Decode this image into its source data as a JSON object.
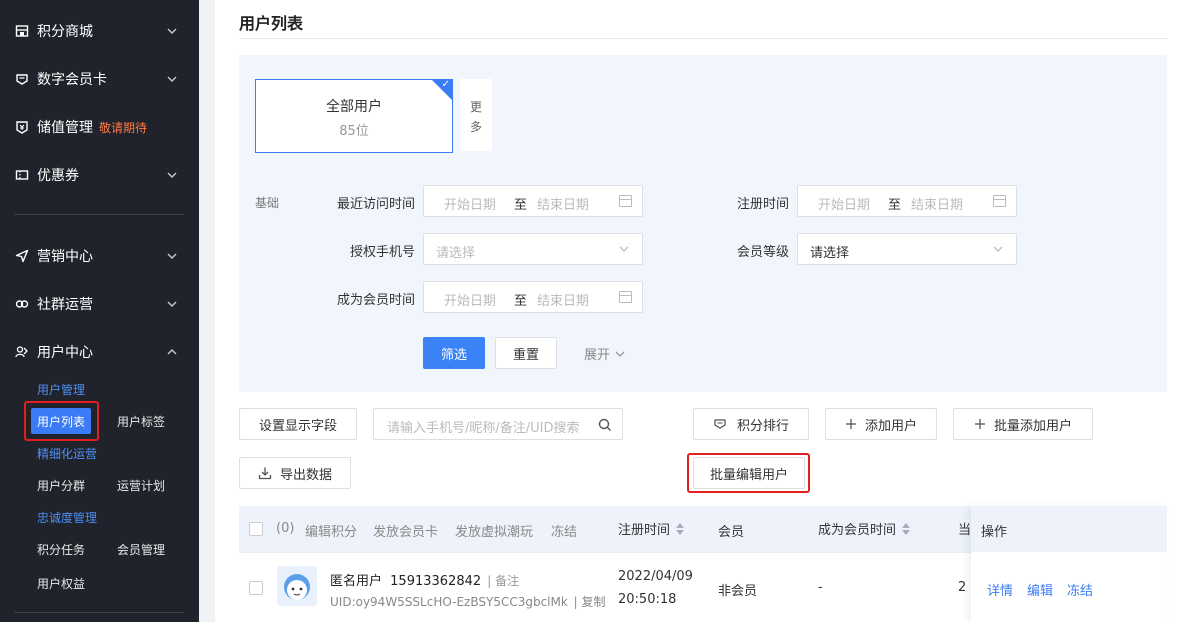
{
  "sidebar": {
    "items": [
      {
        "label": "积分商城",
        "icon": "store-icon"
      },
      {
        "label": "数字会员卡",
        "icon": "member-card-icon"
      },
      {
        "label": "储值管理",
        "icon": "wallet-icon",
        "tag": "敬请期待"
      },
      {
        "label": "优惠券",
        "icon": "coupon-icon"
      },
      {
        "label": "营销中心",
        "icon": "send-icon"
      },
      {
        "label": "社群运营",
        "icon": "community-icon"
      },
      {
        "label": "用户中心",
        "icon": "users-icon"
      }
    ],
    "groups": {
      "user_management": "用户管理",
      "refined_operation": "精细化运营",
      "loyalty_management": "忠诚度管理"
    },
    "links": {
      "user_list": "用户列表",
      "user_tags": "用户标签",
      "user_segments": "用户分群",
      "operation_plan": "运营计划",
      "points_tasks": "积分任务",
      "member_management": "会员管理",
      "user_rights": "用户权益"
    }
  },
  "page": {
    "title": "用户列表"
  },
  "filter": {
    "card_all": {
      "label": "全部用户",
      "count": "85位"
    },
    "more": [
      "更",
      "多"
    ],
    "group_label": "基础",
    "recent_visit_label": "最近访问时间",
    "register_time_label": "注册时间",
    "phone_label": "授权手机号",
    "level_label": "会员等级",
    "member_time_label": "成为会员时间",
    "start_placeholder": "开始日期",
    "end_placeholder": "结束日期",
    "to": "至",
    "select_placeholder": "请选择",
    "filter_btn": "筛选",
    "reset_btn": "重置",
    "expand": "展开"
  },
  "toolbar": {
    "display_fields": "设置显示字段",
    "search_placeholder": "请输入手机号/昵称/备注/UID搜索",
    "points_rank": "积分排行",
    "add_user": "添加用户",
    "batch_add_user": "批量添加用户",
    "export_data": "导出数据",
    "batch_edit_user": "批量编辑用户"
  },
  "table": {
    "selected_count": "(0)",
    "bulk_actions": [
      "编辑积分",
      "发放会员卡",
      "发放虚拟潮玩",
      "冻结"
    ],
    "columns": {
      "register_time": "注册时间",
      "member": "会员",
      "become_member_time": "成为会员时间",
      "current": "当",
      "operations": "操作"
    },
    "rows": [
      {
        "name": "匿名用户",
        "phone": "15913362842",
        "note": "| 备注",
        "uid": "UID:oy94W5SSLcHO-EzBSY5CC3gbclMk",
        "copy": "| 复制",
        "register_date": "2022/04/09",
        "register_clock": "20:50:18",
        "member": "非会员",
        "become_member_time": "-",
        "current": "2",
        "ops": [
          "详情",
          "编辑",
          "冻结"
        ]
      }
    ]
  },
  "colors": {
    "sidebar_bg": "#20232b",
    "accent": "#3b7bf6",
    "highlight_red": "#e02020",
    "tag_orange": "#ff7a45"
  }
}
